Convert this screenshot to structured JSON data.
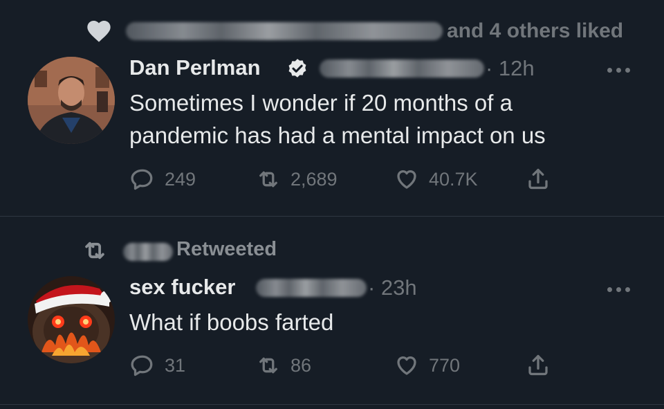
{
  "tweet1": {
    "social_context": "and 4 others liked",
    "author_name": "Dan Perlman",
    "time": "· 12h",
    "text": "Sometimes I wonder if 20 months of a pandemic has had a mental impact on us",
    "replies": "249",
    "retweets": "2,689",
    "likes": "40.7K"
  },
  "tweet2": {
    "social_context": "Retweeted",
    "author_name": "sex fucker",
    "time": "· 23h",
    "text": "What if boobs farted",
    "replies": "31",
    "retweets": "86",
    "likes": "770"
  },
  "icons": {
    "like": "heart-icon",
    "retweet": "retweet-icon",
    "reply": "reply-icon",
    "share": "share-icon",
    "verified": "verified-badge-icon",
    "more": "more-icon"
  },
  "colors": {
    "background": "#161d26",
    "text_primary": "#e7e9ea",
    "text_secondary": "#71767b",
    "divider": "#2f3741"
  }
}
